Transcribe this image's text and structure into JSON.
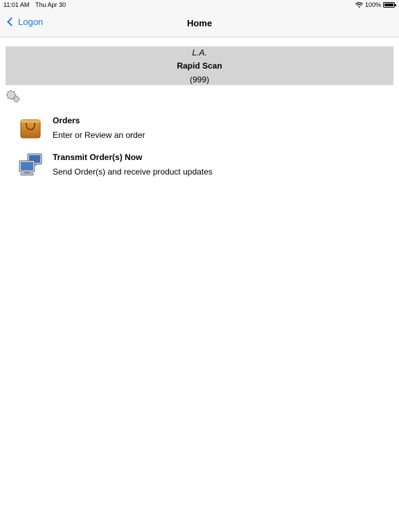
{
  "status_bar": {
    "time": "11:01 AM",
    "date": "Thu Apr 30",
    "battery": "100%",
    "icons": [
      "wifi-icon",
      "battery-icon"
    ]
  },
  "nav": {
    "back_label": "Logon",
    "title": "Home"
  },
  "store": {
    "line1": "L.A.",
    "line2": "Rapid Scan",
    "line3": "(999)"
  },
  "menu": [
    {
      "icon": "shopping-bag-icon",
      "title": "Orders",
      "subtitle": "Enter or Review an order"
    },
    {
      "icon": "network-computers-icon",
      "title": "Transmit Order(s) Now",
      "subtitle": "Send Order(s) and receive product updates"
    }
  ],
  "colors": {
    "accent": "#1d7cf2",
    "banner_bg": "#d4d4d4",
    "bar_bg": "#f7f7f7"
  }
}
